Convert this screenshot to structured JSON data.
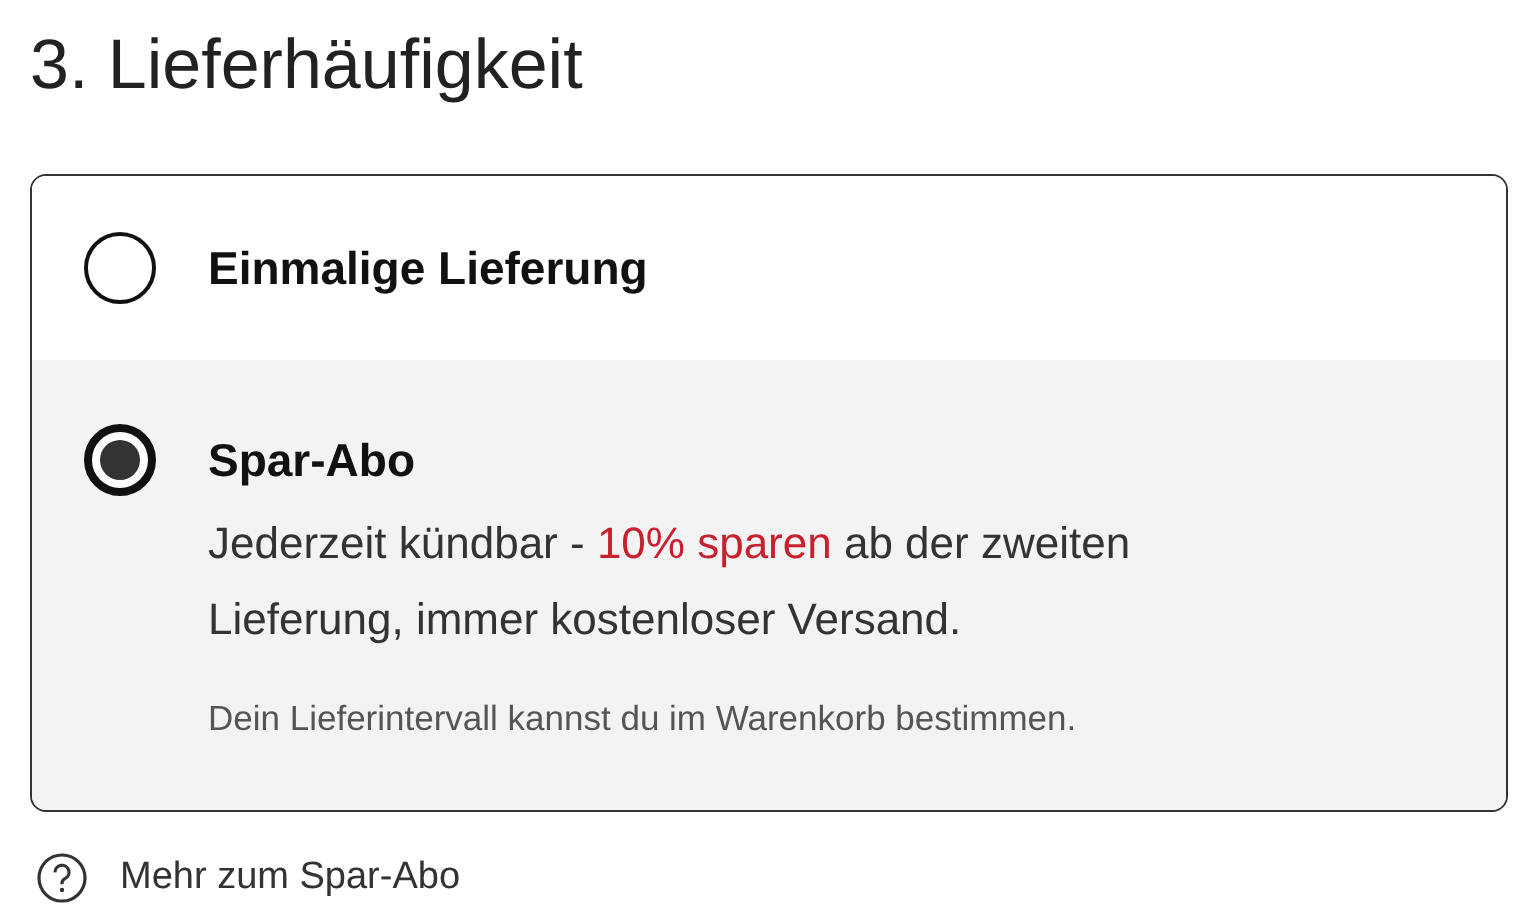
{
  "heading": "3. Lieferhäufigkeit",
  "options": [
    {
      "label": "Einmalige Lieferung",
      "selected": false
    },
    {
      "label": "Spar-Abo",
      "selected": true,
      "description": [
        {
          "text": "Jederzeit kündbar - ",
          "highlight": false
        },
        {
          "text": "10% sparen",
          "highlight": true
        },
        {
          "text": " ab der zweiten Lieferung, immer kostenloser Versand.",
          "highlight": false
        }
      ],
      "note": "Dein Lieferintervall kannst du im Warenkorb bestimmen."
    }
  ],
  "help_link": "Mehr zum Spar-Abo"
}
